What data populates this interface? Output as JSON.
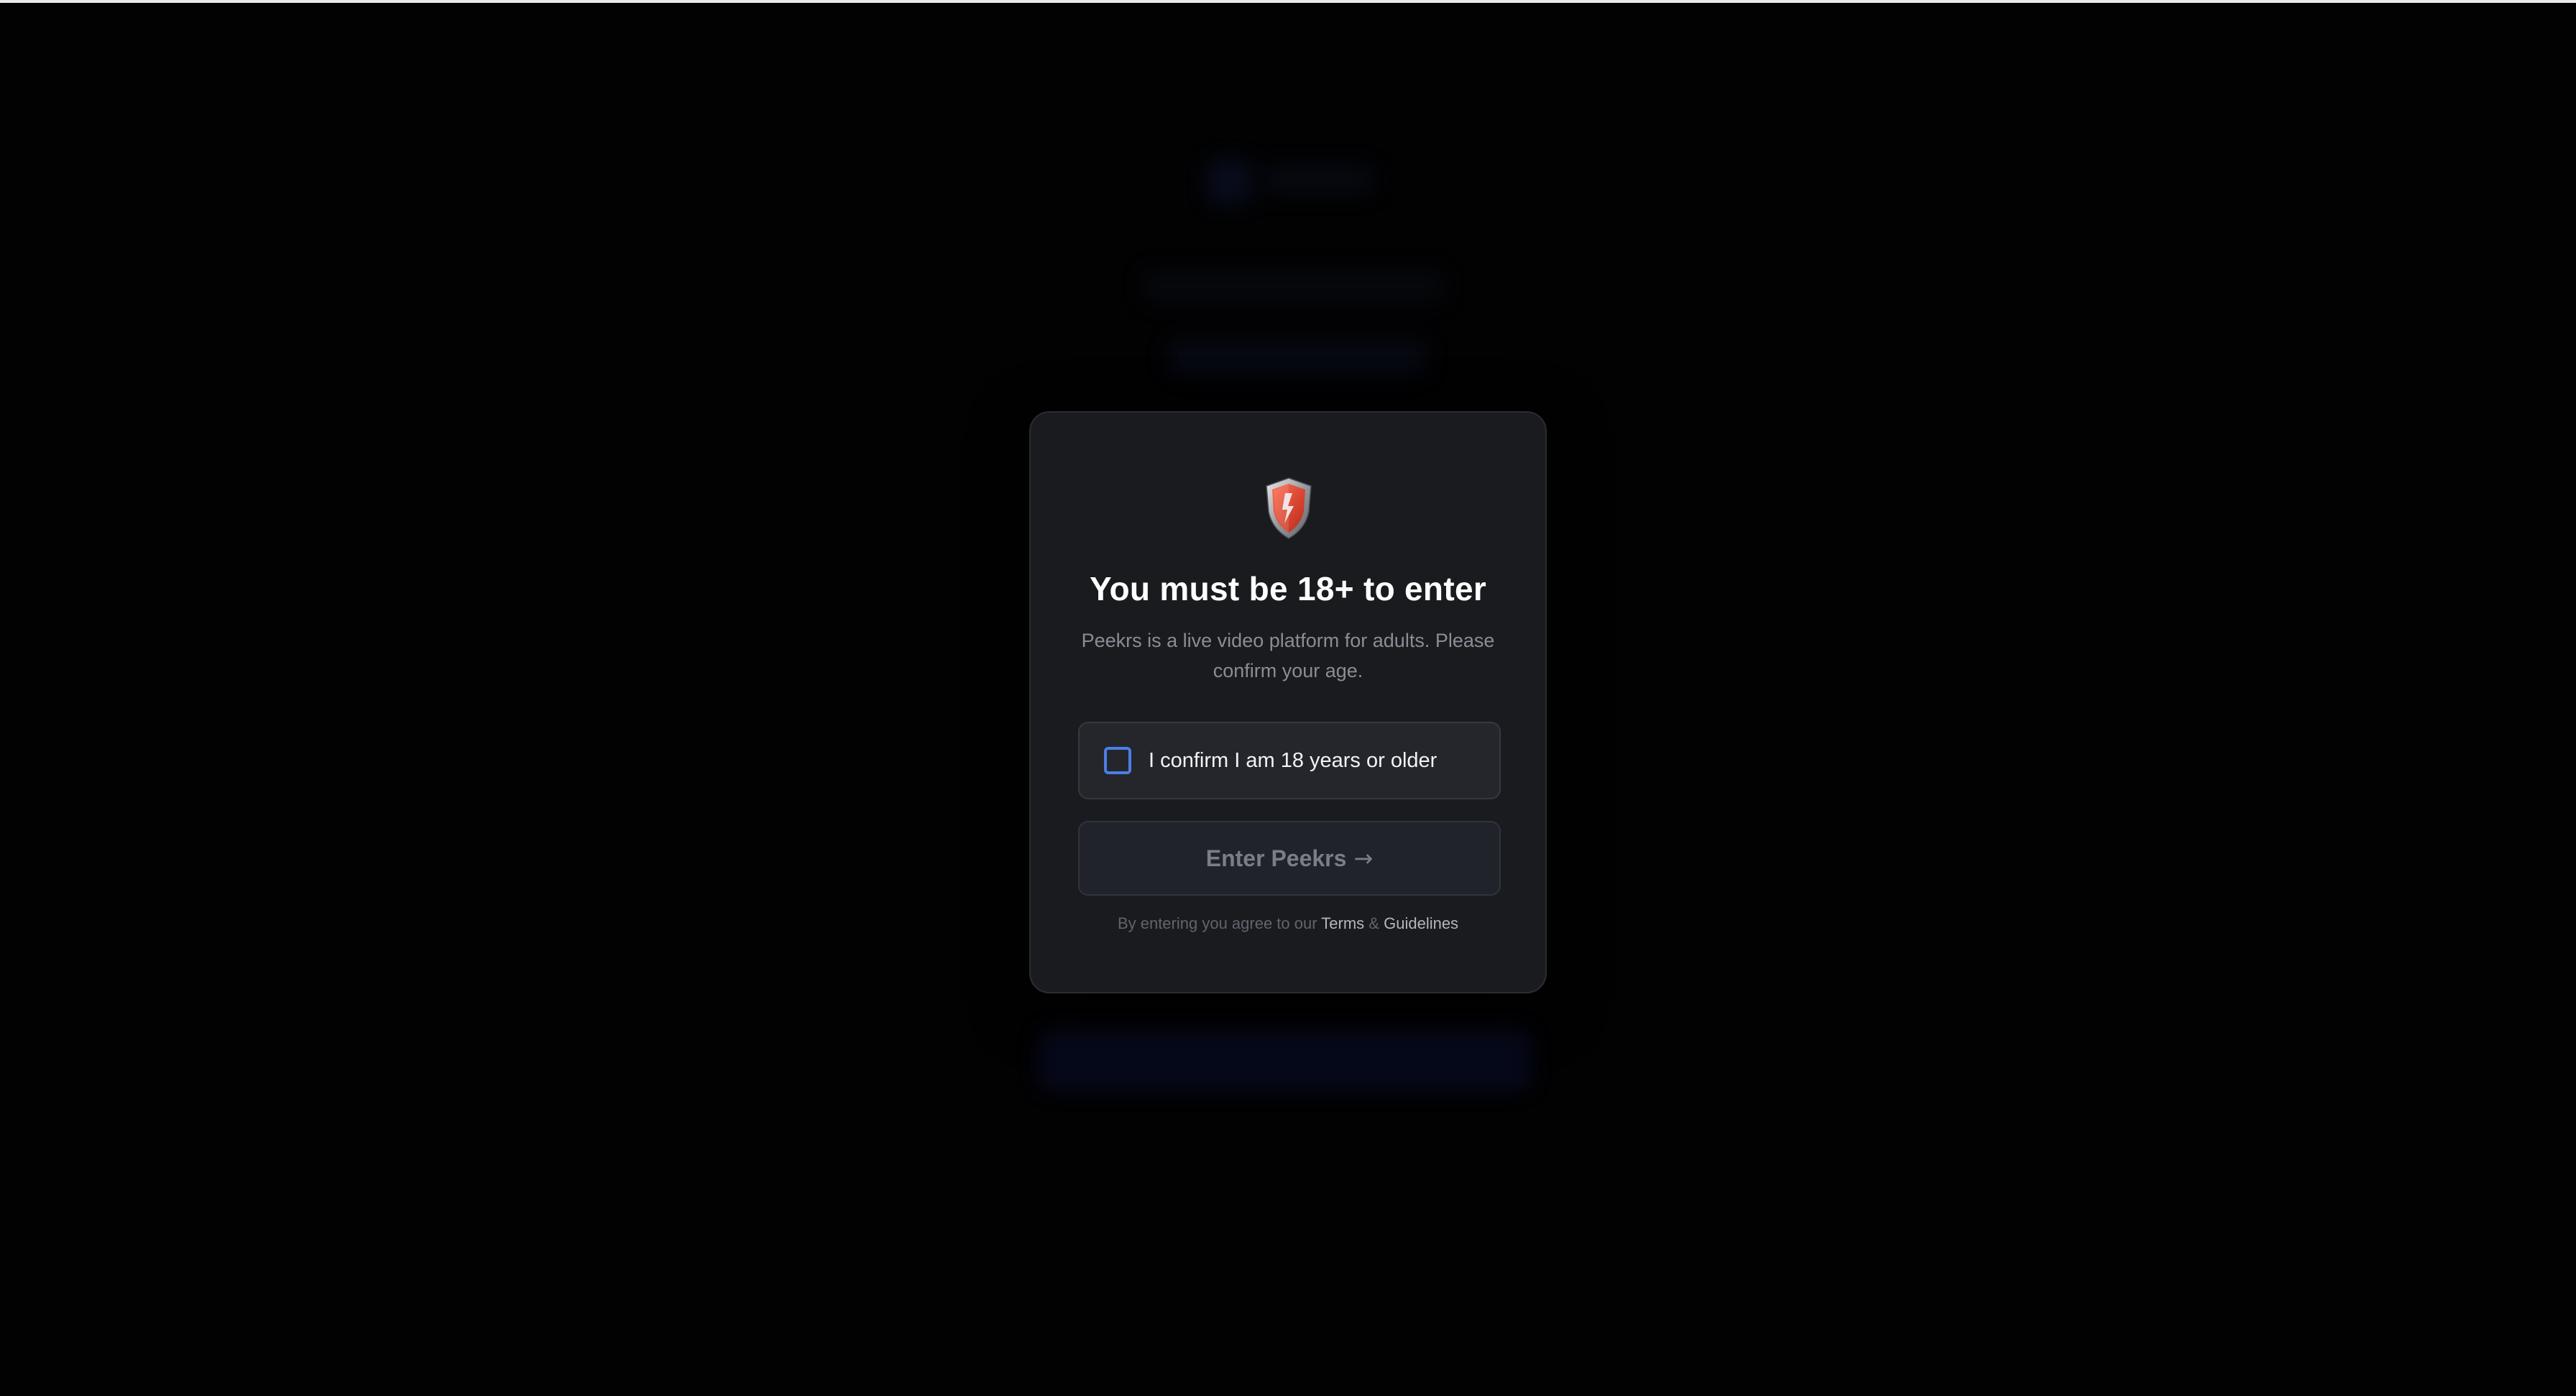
{
  "background": {
    "blurred": true
  },
  "modal": {
    "icon": "shield-icon",
    "title": "You must be 18+ to enter",
    "subtitle": "Peekrs is a live video platform for adults. Please confirm your age.",
    "confirm_checkbox": {
      "label": "I confirm I am 18 years or older",
      "checked": false
    },
    "enter_button": {
      "label": "Enter Peekrs",
      "arrow": "→",
      "disabled": true
    },
    "footer": {
      "prefix": "By entering you agree to our",
      "terms_link": "Terms",
      "separator": "&",
      "guidelines_link": "Guidelines"
    }
  },
  "colors": {
    "page_background": "#020203",
    "modal_background": "#1a1b1f",
    "checkbox_accent": "#4a7fe6",
    "shield_red": "#e0432e",
    "button_disabled_text": "#7a7e89"
  }
}
